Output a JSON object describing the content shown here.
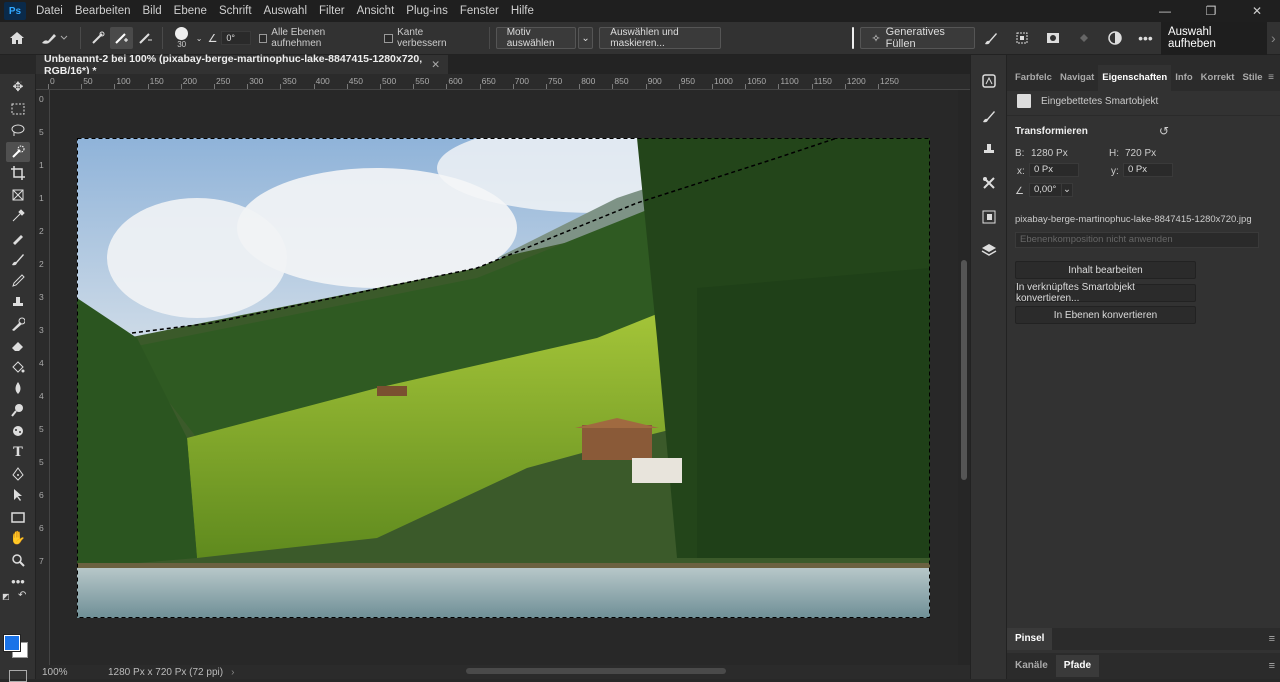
{
  "app": {
    "logo": "Ps"
  },
  "menu": [
    "Datei",
    "Bearbeiten",
    "Bild",
    "Ebene",
    "Schrift",
    "Auswahl",
    "Filter",
    "Ansicht",
    "Plug-ins",
    "Fenster",
    "Hilfe"
  ],
  "window_controls": {
    "minimize": "—",
    "restore": "❐",
    "close": "✕"
  },
  "options_bar": {
    "brush_size": "30",
    "angle": "0°",
    "sample_all_layers": "Alle Ebenen aufnehmen",
    "enhance_edge": "Kante verbessern",
    "select_subject": "Motiv auswählen",
    "select_and_mask": "Auswählen und maskieren...",
    "generative_fill": "Generatives Füllen",
    "deselect": "Auswahl aufheben"
  },
  "document": {
    "tab_title": "Unbenannt-2 bei 100% (pixabay-berge-martinophuc-lake-8847415-1280x720, RGB/16*) *",
    "zoom": "100%",
    "info": "1280 Px x 720 Px (72 ppi)"
  },
  "ruler_top": [
    "0",
    "50",
    "100",
    "150",
    "200",
    "250",
    "300",
    "350",
    "400",
    "450",
    "500",
    "550",
    "600",
    "650",
    "700",
    "750",
    "800",
    "850",
    "900",
    "950",
    "1000",
    "1050",
    "1100",
    "1150",
    "1200",
    "1250"
  ],
  "ruler_left": [
    "0",
    "5",
    "1",
    "1",
    "2",
    "2",
    "3",
    "3",
    "4",
    "4",
    "5",
    "5",
    "6",
    "6",
    "7"
  ],
  "panel": {
    "tabs": [
      "Farbfelc",
      "Navigat",
      "Eigenschaften",
      "Info",
      "Korrekt",
      "Stile"
    ],
    "active_tab": "Eigenschaften",
    "object_type": "Eingebettetes Smartobjekt",
    "transform_title": "Transformieren",
    "w_label": "B:",
    "w_value": "1280 Px",
    "h_label": "H:",
    "h_value": "720 Px",
    "x_label": "x:",
    "x_value": "0 Px",
    "y_label": "y:",
    "y_value": "0 Px",
    "angle_value": "0,00°",
    "filename": "pixabay-berge-martinophuc-lake-8847415-1280x720.jpg",
    "layer_comp": "Ebenenkomposition nicht anwenden",
    "btn_edit": "Inhalt bearbeiten",
    "btn_convert_linked": "In verknüpftes Smartobjekt konvertieren...",
    "btn_convert_layers": "In Ebenen konvertieren",
    "bottom_tab1": "Pinsel",
    "bottom_tab2a": "Kanäle",
    "bottom_tab2b": "Pfade"
  },
  "colors": {
    "foreground": "#1a73e8",
    "background": "#ffffff"
  }
}
